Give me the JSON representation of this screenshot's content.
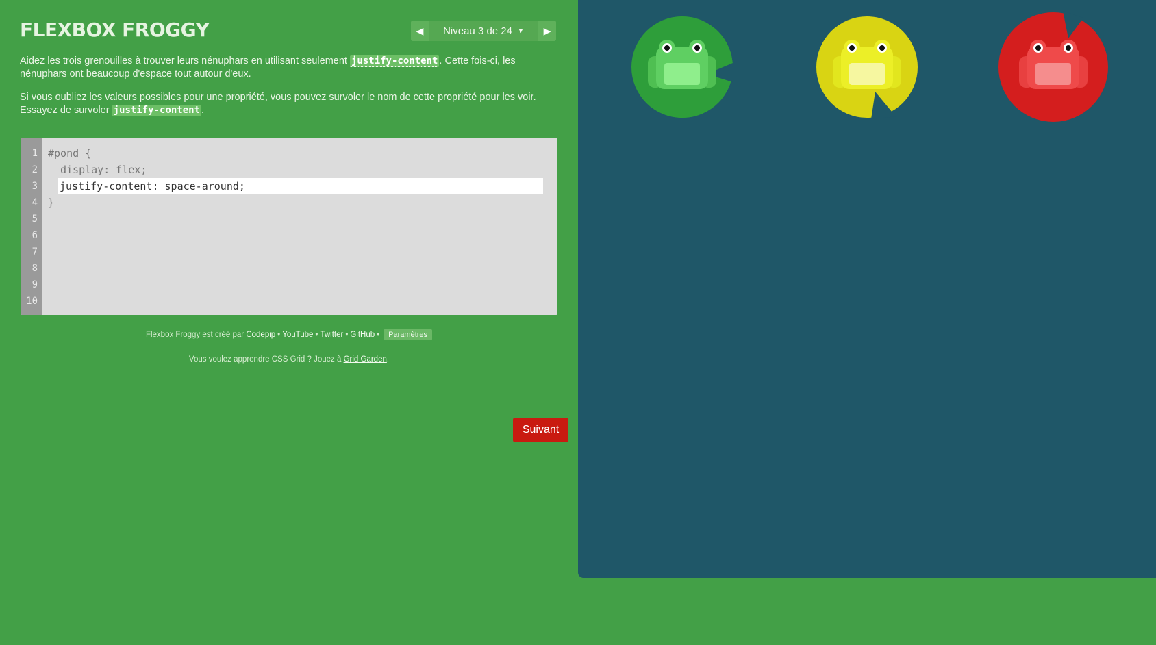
{
  "app": {
    "title": "Flexbox Froggy"
  },
  "level_nav": {
    "prev_icon": "triangle-left-icon",
    "next_icon": "triangle-right-icon",
    "level_text": "Niveau 3 de 24",
    "caret_icon": "caret-down-icon"
  },
  "instructions": {
    "p1_before": "Aidez les trois grenouilles à trouver leurs nénuphars en utilisant seulement ",
    "p1_code": "justify-content",
    "p1_after": ". Cette fois-ci, les nénuphars ont beaucoup d'espace tout autour d'eux.",
    "p2_before": "Si vous oubliez les valeurs possibles pour une propriété, vous pouvez survoler le nom de cette propriété pour les voir. Essayez de survoler ",
    "p2_code": "justify-content",
    "p2_after": "."
  },
  "editor": {
    "line_numbers": [
      "1",
      "2",
      "3",
      "4",
      "5",
      "6",
      "7",
      "8",
      "9",
      "10"
    ],
    "line1": "#pond {",
    "line2": "display: flex;",
    "input_value": "justify-content: space-around;",
    "line4": "}",
    "next_label": "Suivant"
  },
  "credits": {
    "prefix": "Flexbox Froggy est créé par ",
    "link_codepip": "Codepip",
    "link_youtube": "YouTube",
    "link_twitter": "Twitter",
    "link_github": "GitHub",
    "separator": "•",
    "settings_label": "Paramètres",
    "line2_prefix": "Vous voulez apprendre CSS Grid ? Jouez à ",
    "link_gridgarden": "Grid Garden",
    "line2_suffix": "."
  },
  "colors": {
    "background_green": "#43a047",
    "pond_blue": "#1f5768",
    "next_button_red": "#c91a10",
    "lilypad_green": "#2e9e3a",
    "lilypad_yellow": "#d9d413",
    "lilypad_red": "#d41e1e",
    "frog_green": "#5fcf62",
    "frog_yellow": "#ecef27",
    "frog_red": "#ef4a4a"
  },
  "pond": {
    "frogs": [
      {
        "color": "green",
        "icon": "frog-icon"
      },
      {
        "color": "yellow",
        "icon": "frog-icon"
      },
      {
        "color": "red",
        "icon": "frog-icon"
      }
    ]
  }
}
